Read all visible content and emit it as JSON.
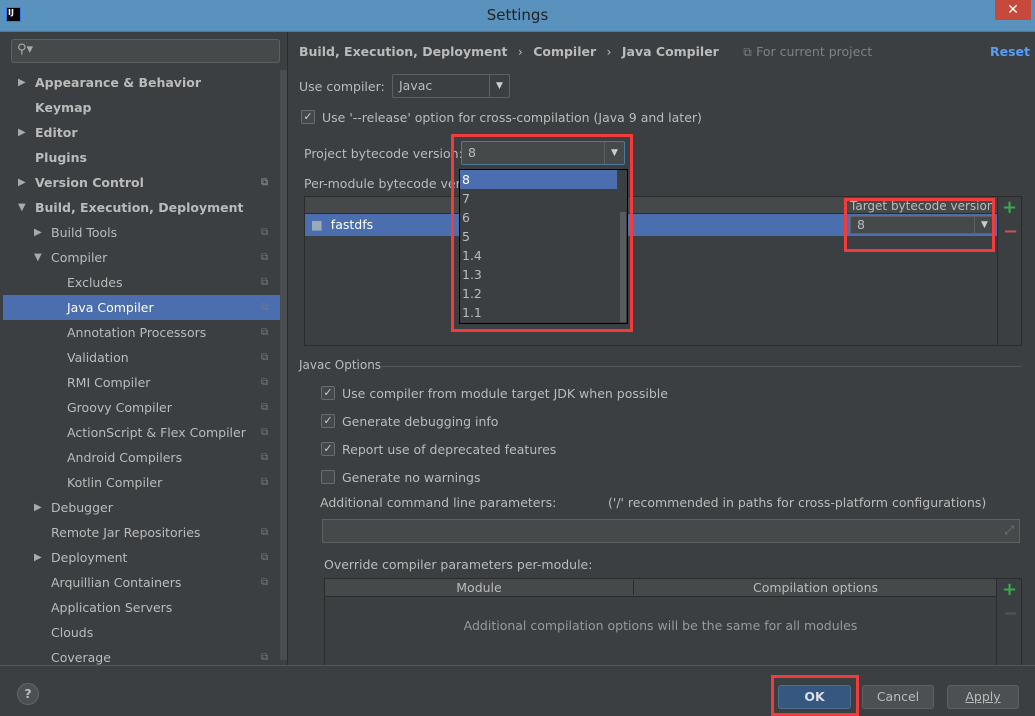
{
  "window": {
    "title": "Settings",
    "logo": "IJ",
    "close": "✕"
  },
  "search": {
    "placeholder": ""
  },
  "sidebar": {
    "items": [
      {
        "label": "Appearance & Behavior",
        "level": 0,
        "bold": true,
        "arrow": "right"
      },
      {
        "label": "Keymap",
        "level": 0,
        "bold": true
      },
      {
        "label": "Editor",
        "level": 0,
        "bold": true,
        "arrow": "right"
      },
      {
        "label": "Plugins",
        "level": 0,
        "bold": true
      },
      {
        "label": "Version Control",
        "level": 0,
        "bold": true,
        "arrow": "right",
        "copy": true
      },
      {
        "label": "Build, Execution, Deployment",
        "level": 0,
        "bold": true,
        "arrow": "down"
      },
      {
        "label": "Build Tools",
        "level": 1,
        "arrow": "right",
        "copy": true
      },
      {
        "label": "Compiler",
        "level": 1,
        "arrow": "down",
        "copy": true
      },
      {
        "label": "Excludes",
        "level": 2,
        "copy": true
      },
      {
        "label": "Java Compiler",
        "level": 2,
        "copy": true,
        "selected": true
      },
      {
        "label": "Annotation Processors",
        "level": 2,
        "copy": true
      },
      {
        "label": "Validation",
        "level": 2,
        "copy": true
      },
      {
        "label": "RMI Compiler",
        "level": 2,
        "copy": true
      },
      {
        "label": "Groovy Compiler",
        "level": 2,
        "copy": true
      },
      {
        "label": "ActionScript & Flex Compiler",
        "level": 2,
        "copy": true
      },
      {
        "label": "Android Compilers",
        "level": 2,
        "copy": true
      },
      {
        "label": "Kotlin Compiler",
        "level": 2,
        "copy": true
      },
      {
        "label": "Debugger",
        "level": 1,
        "arrow": "right"
      },
      {
        "label": "Remote Jar Repositories",
        "level": 1,
        "copy": true
      },
      {
        "label": "Deployment",
        "level": 1,
        "arrow": "right",
        "copy": true
      },
      {
        "label": "Arquillian Containers",
        "level": 1,
        "copy": true
      },
      {
        "label": "Application Servers",
        "level": 1
      },
      {
        "label": "Clouds",
        "level": 1
      },
      {
        "label": "Coverage",
        "level": 1,
        "copy": true
      }
    ]
  },
  "breadcrumb": {
    "items": [
      "Build, Execution, Deployment",
      "Compiler",
      "Java Compiler"
    ],
    "sep": "›",
    "scope": "For current project",
    "reset": "Reset"
  },
  "compiler": {
    "label": "Use compiler:",
    "value": "Javac"
  },
  "release_option": {
    "label": "Use '--release' option for cross-compilation (Java 9 and later)",
    "checked": true
  },
  "bytecode": {
    "label": "Project bytecode version:",
    "value": "8",
    "per_module_label": "Per-module bytecode versi",
    "options": [
      "8",
      "7",
      "6",
      "5",
      "1.4",
      "1.3",
      "1.2",
      "1.1"
    ],
    "selected": "8"
  },
  "module_table": {
    "target_header": "Target bytecode version",
    "rows": [
      {
        "module": "fastdfs",
        "target": "8"
      }
    ]
  },
  "javac": {
    "section": "Javac Options",
    "options": [
      {
        "label": "Use compiler from module target JDK when possible",
        "checked": true
      },
      {
        "label": "Generate debugging info",
        "checked": true
      },
      {
        "label": "Report use of deprecated features",
        "checked": true
      },
      {
        "label": "Generate no warnings",
        "checked": false
      }
    ],
    "cmd_label": "Additional command line parameters:",
    "cmd_hint": "('/' recommended in paths for cross-platform configurations)",
    "cmd_value": "",
    "override_label": "Override compiler parameters per-module:",
    "override_headers": [
      "Module",
      "Compilation options"
    ],
    "override_empty": "Additional compilation options will be the same for all modules"
  },
  "footer": {
    "help": "?",
    "ok": "OK",
    "cancel": "Cancel",
    "apply": "Apply"
  },
  "colors": {
    "accent": "#4b6eaf",
    "highlight": "#f03c3c",
    "link": "#589df6"
  }
}
